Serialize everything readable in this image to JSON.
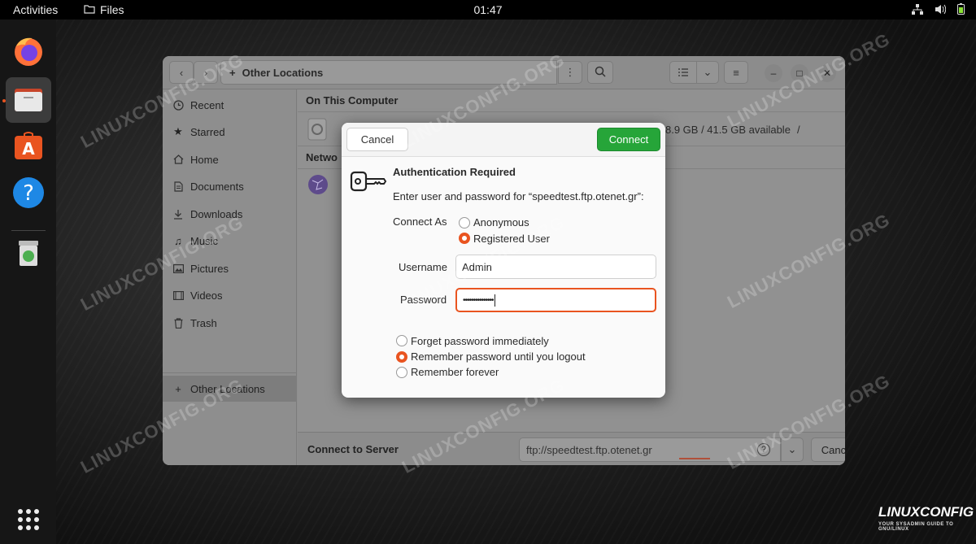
{
  "topbar": {
    "activities": "Activities",
    "app_name": "Files",
    "clock": "01:47",
    "icons": [
      "network-icon",
      "volume-icon",
      "battery-icon"
    ]
  },
  "dock": {
    "apps": [
      "firefox-icon",
      "files-icon",
      "software-center-icon",
      "help-icon",
      "trash-icon"
    ],
    "apps_grid_icon": "apps-grid-icon"
  },
  "files_window": {
    "path_label": "Other Locations",
    "sidebar": {
      "items": [
        {
          "label": "Recent",
          "icon": "clock-icon"
        },
        {
          "label": "Starred",
          "icon": "star-icon"
        },
        {
          "label": "Home",
          "icon": "home-icon"
        },
        {
          "label": "Documents",
          "icon": "document-icon"
        },
        {
          "label": "Downloads",
          "icon": "download-icon"
        },
        {
          "label": "Music",
          "icon": "music-icon"
        },
        {
          "label": "Pictures",
          "icon": "picture-icon"
        },
        {
          "label": "Videos",
          "icon": "video-icon"
        },
        {
          "label": "Trash",
          "icon": "trash-icon"
        },
        {
          "label": "Other Locations",
          "icon": "plus-icon"
        }
      ]
    },
    "main": {
      "on_this_computer": "On This Computer",
      "disk_info": "8.9 GB / 41.5 GB available",
      "disk_path": "/",
      "networks_heading": "Netwo"
    },
    "bottombar": {
      "label": "Connect to Server",
      "server_address": "ftp://speedtest.ftp.otenet.gr",
      "cancel": "Cancel"
    }
  },
  "dialog": {
    "cancel": "Cancel",
    "connect": "Connect",
    "title": "Authentication Required",
    "message": "Enter user and password for “speedtest.ftp.otenet.gr”:",
    "connect_as_label": "Connect As",
    "connect_as_options": [
      {
        "label": "Anonymous",
        "selected": false
      },
      {
        "label": "Registered User",
        "selected": true
      }
    ],
    "username_label": "Username",
    "username_value": "Admin",
    "password_label": "Password",
    "password_value": "•••••••••••••••",
    "remember_options": [
      {
        "label": "Forget password immediately",
        "selected": false
      },
      {
        "label": "Remember password until you logout",
        "selected": true
      },
      {
        "label": "Remember forever",
        "selected": false
      }
    ]
  },
  "watermark": "LINUXCONFIG.ORG",
  "brand": {
    "name": "LINUXCONFIG",
    "tagline": "YOUR SYSADMIN GUIDE TO GNU/LINUX"
  },
  "colors": {
    "accent": "#e95420",
    "connect_button": "#26a539"
  }
}
